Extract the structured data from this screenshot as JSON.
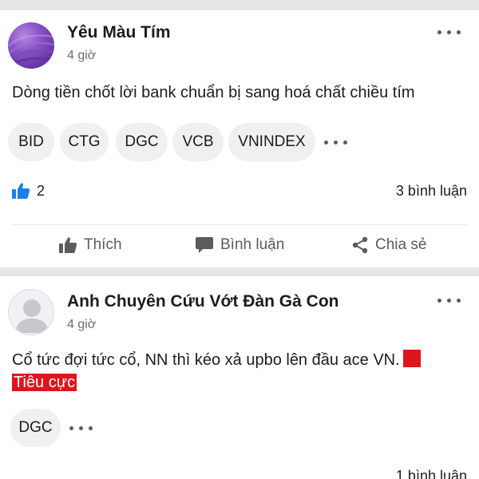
{
  "posts": [
    {
      "author": "Yêu Màu Tím",
      "time": "4 giờ",
      "content": "Dòng tiền chốt lời bank chuẩn bị sang hoá chất chiều tím",
      "tags": [
        "BID",
        "CTG",
        "DGC",
        "VCB",
        "VNINDEX"
      ],
      "like_count": "2",
      "comment_count": "3 bình luận",
      "actions": {
        "like": "Thích",
        "comment": "Bình luận",
        "share": "Chia sẻ"
      }
    },
    {
      "author": "Anh Chuyên Cứu Vớt Đàn Gà Con",
      "time": "4 giờ",
      "content": "Cổ tức đợi tức cổ, NN thì kéo xả upbo lên đầu ace VN.",
      "sentiment": "Tiêu cực",
      "tags": [
        "DGC"
      ],
      "comment_count": "1 bình luận"
    }
  ],
  "colors": {
    "accent": "#1a7fe8",
    "negative": "#e0141d",
    "separator": "#e6e6e8"
  }
}
